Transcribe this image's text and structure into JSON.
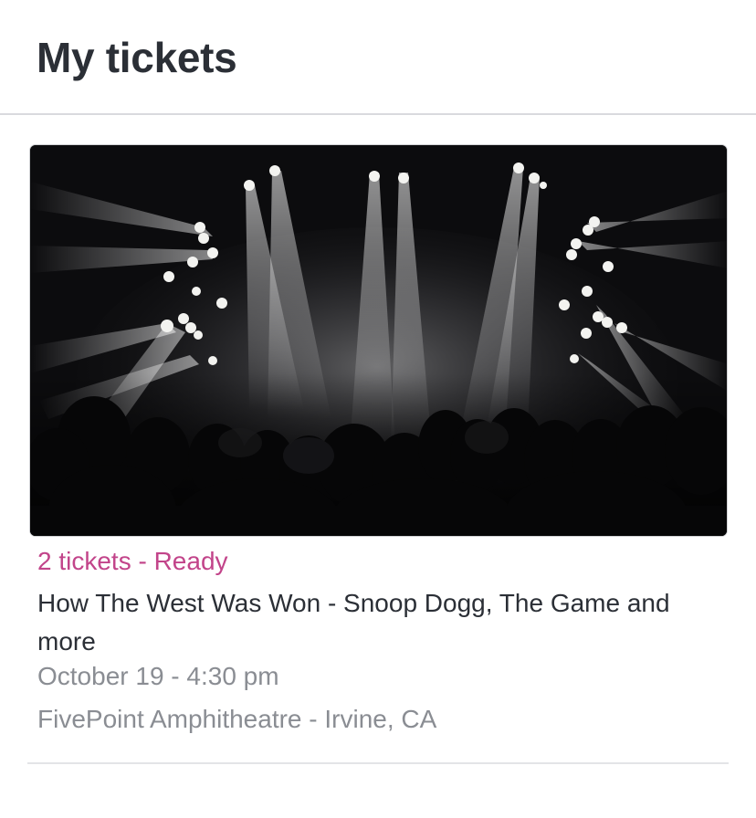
{
  "header": {
    "title": "My tickets"
  },
  "tickets": [
    {
      "image_icon": "concert-photo",
      "status": "2 tickets - Ready",
      "status_color": "#c2448a",
      "name": "How The West Was Won - Snoop Dogg, The Game and more",
      "date": "October 19 - 4:30 pm",
      "venue": "FivePoint Amphitheatre - Irvine, CA"
    }
  ]
}
